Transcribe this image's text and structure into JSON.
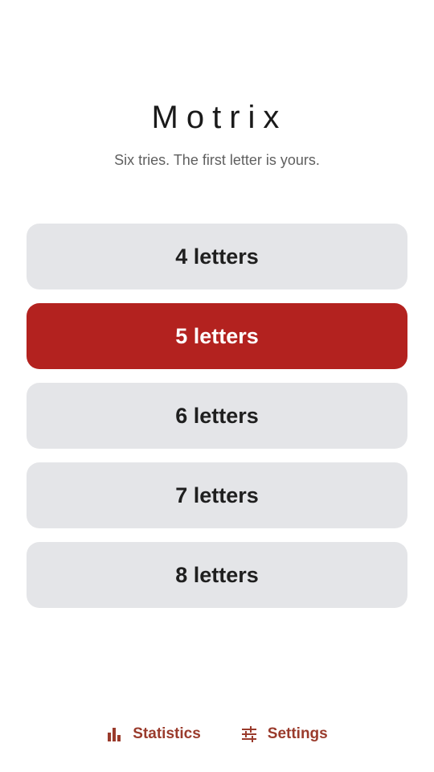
{
  "app": {
    "title": "Motrix",
    "subtitle": "Six tries. The first letter is yours."
  },
  "options": [
    {
      "label": "4 letters",
      "selected": false
    },
    {
      "label": "5 letters",
      "selected": true
    },
    {
      "label": "6 letters",
      "selected": false
    },
    {
      "label": "7 letters",
      "selected": false
    },
    {
      "label": "8 letters",
      "selected": false
    }
  ],
  "footer": {
    "statistics": {
      "label": "Statistics",
      "icon": "bar-chart-icon"
    },
    "settings": {
      "label": "Settings",
      "icon": "sliders-icon"
    }
  },
  "colors": {
    "accent": "#b3221f",
    "option_bg": "#e4e5e8",
    "footer_text": "#9a3b2c"
  }
}
